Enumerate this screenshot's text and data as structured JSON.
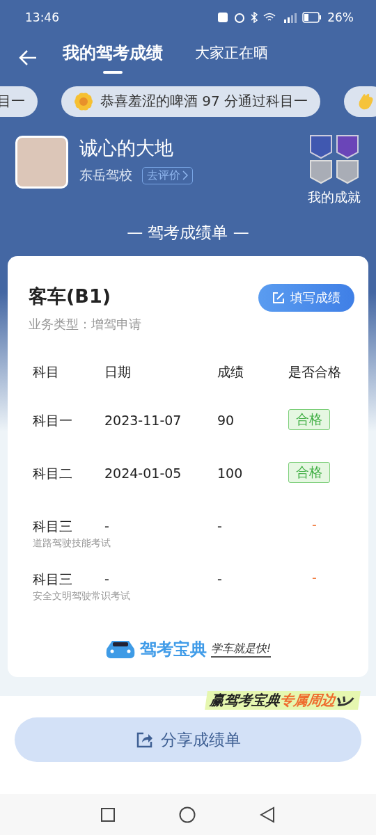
{
  "status_bar": {
    "time": "13:46",
    "battery": "26%"
  },
  "header": {
    "tabs": [
      {
        "label": "我的驾考成绩",
        "selected": true
      },
      {
        "label": "大家正在晒",
        "selected": false
      }
    ]
  },
  "ticker": [
    {
      "text": "目一",
      "kind": "plain"
    },
    {
      "text": "恭喜羞涩的啤酒 97 分通过科目一",
      "kind": "flower"
    },
    {
      "kind": "clap"
    }
  ],
  "profile": {
    "name": "诚心的大地",
    "school": "东岳驾校",
    "review_button": "去评价",
    "achievements_label": "我的成就"
  },
  "section_title": "— 驾考成绩单 —",
  "card": {
    "vehicle": "客车(B1)",
    "business_type": "业务类型：增驾申请",
    "fill_button": "填写成绩",
    "columns": [
      "科目",
      "日期",
      "成绩",
      "是否合格"
    ],
    "rows": [
      {
        "subject": "科目一",
        "date": "2023-11-07",
        "score": "90",
        "result": "合格",
        "kind": "badge"
      },
      {
        "subject": "科目二",
        "date": "2024-01-05",
        "score": "100",
        "result": "合格",
        "kind": "badge"
      },
      {
        "subject": "科目三",
        "note": "道路驾驶技能考试",
        "date": "-",
        "score": "-",
        "result": "-",
        "kind": "dash"
      },
      {
        "subject": "科目三",
        "note": "安全文明驾驶常识考试",
        "date": "-",
        "score": "-",
        "result": "-",
        "kind": "dash"
      }
    ],
    "brand": "驾考宝典",
    "slogan": "学车就是快!"
  },
  "promo": {
    "lead": "赢驾考宝典",
    "highlight": "专属周边"
  },
  "share_button": "分享成绩单"
}
